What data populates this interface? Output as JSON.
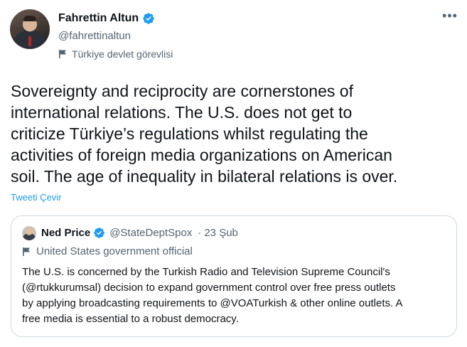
{
  "author": {
    "name": "Fahrettin Altun",
    "handle": "@fahrettinaltun",
    "label": "Türkiye devlet görevlisi"
  },
  "more_icon": "•••",
  "tweet": {
    "text": "Sovereignty and reciprocity are cornerstones of\ninternational relations. The U.S. does not get to\ncriticize Türkiye’s regulations whilst regulating the\nactivities of foreign media organizations on American\nsoil. The age of inequality in bilateral relations is over.",
    "translate_label": "Tweeti Çevir"
  },
  "quote": {
    "name": "Ned Price",
    "handle": "@StateDeptSpox",
    "separator": "·",
    "date": "23 Şub",
    "label": "United States government official",
    "text": "The U.S. is concerned by the Turkish Radio and Television Supreme Council's\n(@rtukkurumsal) decision to expand government control over free press outlets\nby applying broadcasting requirements to @VOATurkish & other online outlets. A\nfree media is essential to a robust democracy."
  },
  "colors": {
    "verified": "#1d9bf0",
    "link": "#1d9bf0",
    "secondary_text": "#536471",
    "border": "#cfd9de"
  },
  "icons": [
    "verified-badge-icon",
    "flag-icon",
    "more-icon"
  ]
}
